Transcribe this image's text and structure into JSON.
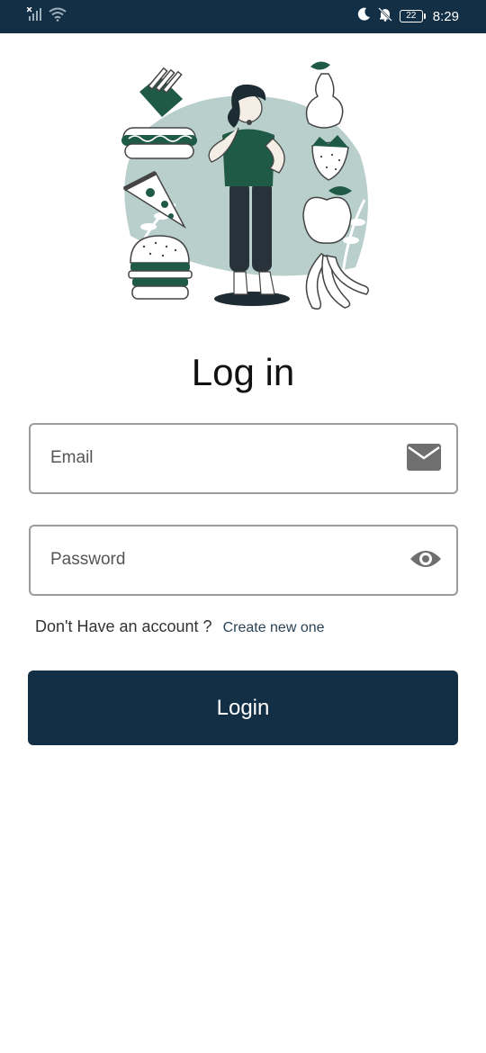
{
  "status_bar": {
    "time": "8:29",
    "battery_level": "22",
    "icons": [
      "signal-off-icon",
      "wifi-icon",
      "moon-icon",
      "bell-off-icon",
      "battery-icon"
    ]
  },
  "login": {
    "title": "Log in",
    "email_placeholder": "Email",
    "password_placeholder": "Password",
    "signup_question": "Don't Have an account ?",
    "signup_link": "Create new one",
    "login_button": "Login"
  },
  "colors": {
    "primary": "#132f45",
    "illustration_green": "#1f5a47",
    "illustration_bg": "#b9cfcb",
    "field_border": "#9c9c9c",
    "icon_gray": "#6f6f6f"
  }
}
